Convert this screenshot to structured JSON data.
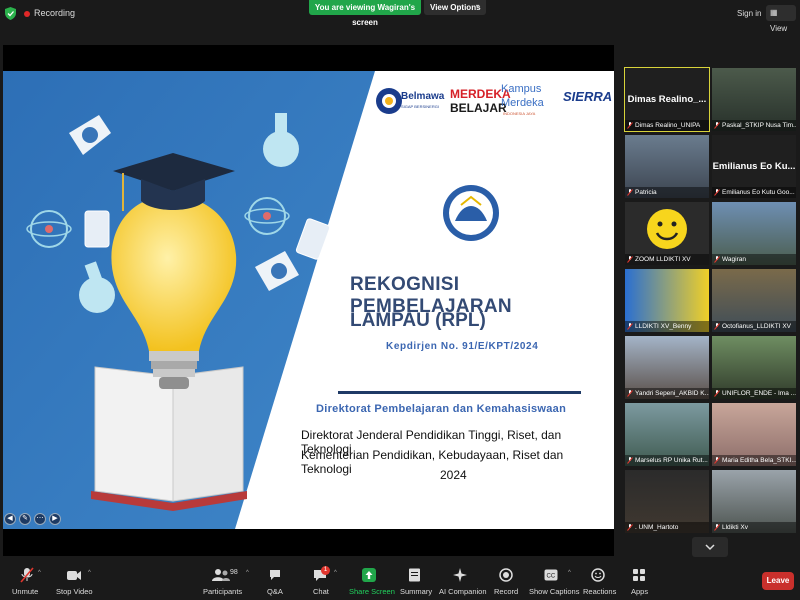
{
  "topbar": {
    "recording_label": "Recording",
    "viewing_banner": "You are viewing Wagiran's screen",
    "view_options_label": "View Options",
    "sign_in_label": "Sign in",
    "view_label": "View"
  },
  "slide": {
    "logos": {
      "belmawa": "Belmawa",
      "belmawa_tagline": "SIGAP BERSINERGI",
      "merdeka_line1": "MERDEKA",
      "merdeka_line2": "BELAJAR",
      "kampus_line1": "Kampus",
      "kampus_line2": "Merdeka",
      "kampus_tagline": "INDONESIA JAYA",
      "sierra": "SIERRA"
    },
    "title_line1": "REKOGNISI PEMBELAJARAN",
    "title_line2": "LAMPAU  (RPL)",
    "decree": "Kepdirjen No. 91/E/KPT/2024",
    "directorate": "Direktorat Pembelajaran dan Kemahasiswaan",
    "line_dirjen": "Direktorat Jenderal Pendidikan Tinggi, Riset, dan Teknologi",
    "line_ministry": "Kementerian Pendidikan, Kebudayaan, Riset dan Teknologi",
    "year": "2024"
  },
  "participants": [
    {
      "name": "Dimas Realino_UNIPA",
      "big_name": "Dimas  Realino_...",
      "active": true
    },
    {
      "name": "Paskal_STKIP Nusa Tim...",
      "big_name": ""
    },
    {
      "name": "Patricia",
      "big_name": ""
    },
    {
      "name": "Emilianus Eo Kutu Goo...",
      "big_name": "Emilianus Eo Ku..."
    },
    {
      "name": "ZOOM LLDIKTI XV",
      "big_name": ""
    },
    {
      "name": "Wagiran",
      "big_name": ""
    },
    {
      "name": "LLDIKTI XV_Benny",
      "big_name": ""
    },
    {
      "name": "Octofianus_LLDIKTI XV",
      "big_name": ""
    },
    {
      "name": "Yandri Sepeni_AKBID K...",
      "big_name": ""
    },
    {
      "name": "UNIFLOR_ENDE - Ima ...",
      "big_name": ""
    },
    {
      "name": "Marselus RP Unika Rut...",
      "big_name": ""
    },
    {
      "name": "Maria Editha Bela_STKI...",
      "big_name": ""
    },
    {
      "name": ". UNM_Hartoto",
      "big_name": ""
    },
    {
      "name": "Lldikti Xv",
      "big_name": ""
    }
  ],
  "toolbar": {
    "unmute": "Unmute",
    "stop_video": "Stop Video",
    "participants": "Participants",
    "participants_count": "98",
    "qa": "Q&A",
    "chat": "Chat",
    "chat_badge": "1",
    "share_screen": "Share Screen",
    "summary": "Summary",
    "ai_companion": "AI Companion",
    "record": "Record",
    "show_captions": "Show Captions",
    "reactions": "Reactions",
    "apps": "Apps",
    "leave": "Leave"
  },
  "colors": {
    "accent_green": "#21a64a",
    "leave_red": "#c9302c",
    "slide_blue": "#2f6db4",
    "active_speaker": "#d8d33a"
  }
}
